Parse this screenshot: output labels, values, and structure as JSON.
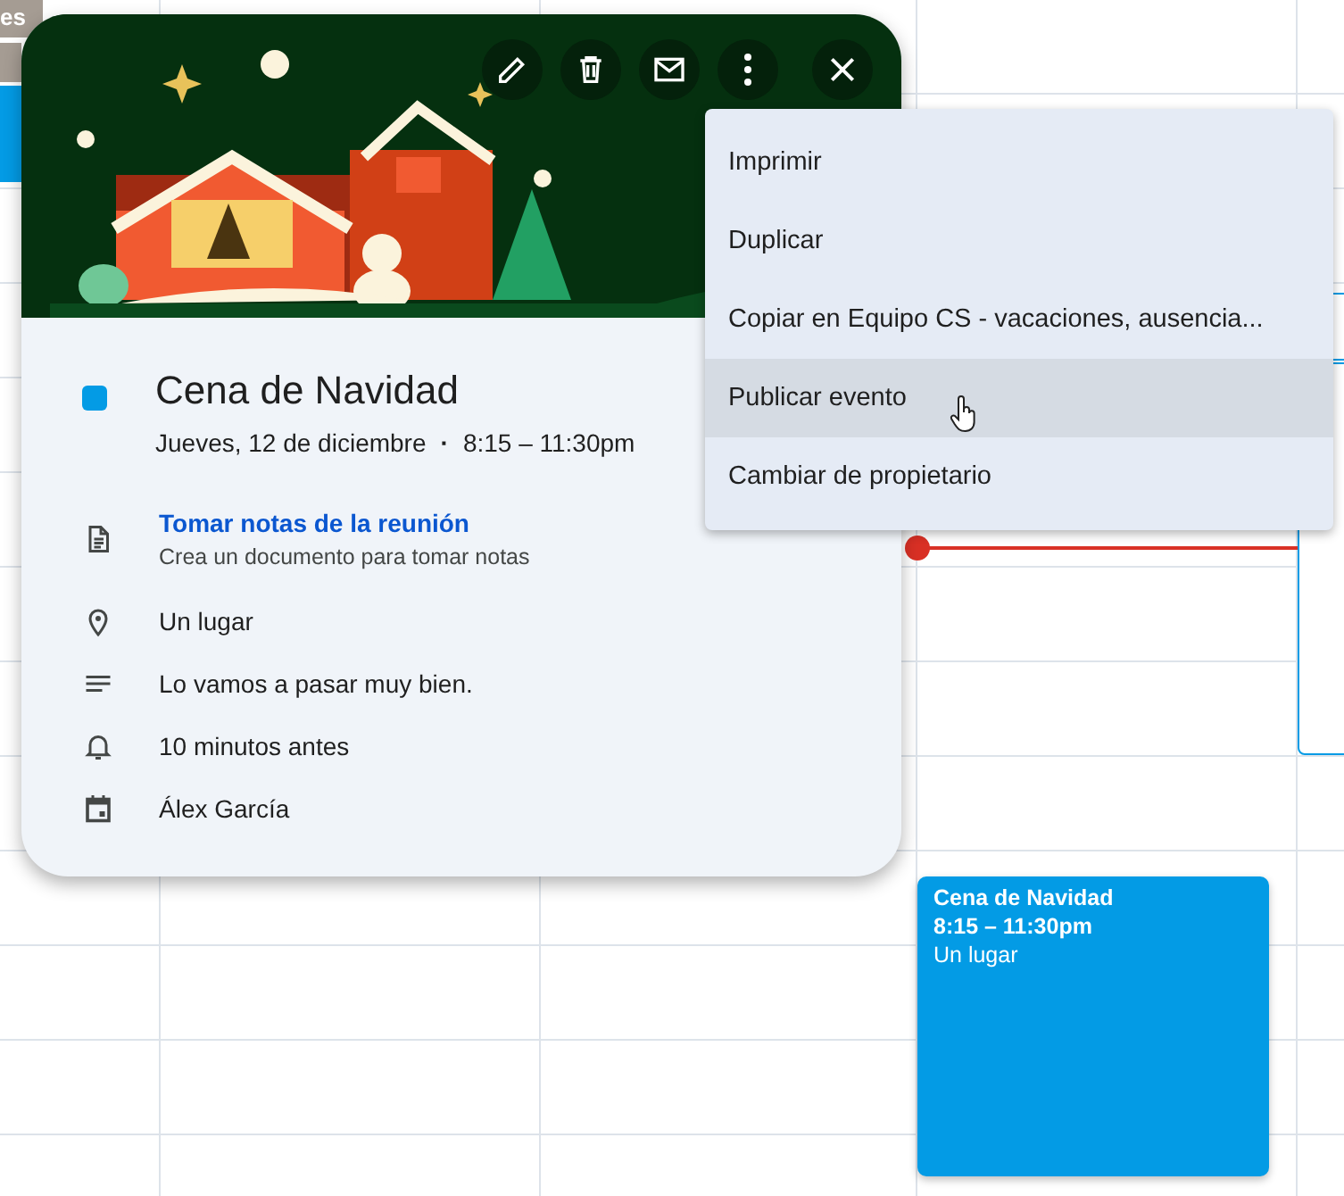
{
  "calendar": {
    "background_chips": [
      {
        "title": "es",
        "color": "#a59c93"
      }
    ],
    "event_block": {
      "title": "Cena de Navidad",
      "time": "8:15 – 11:30pm",
      "location": "Un lugar",
      "color": "#039be5"
    }
  },
  "popup": {
    "toolbar": [
      {
        "kind": "edit"
      },
      {
        "kind": "delete"
      },
      {
        "kind": "email"
      },
      {
        "kind": "more"
      },
      {
        "kind": "close"
      }
    ],
    "event": {
      "title": "Cena de Navidad",
      "color": "#039be5",
      "date": "Jueves, 12 de diciembre",
      "separator": "·",
      "time": "8:15 – 11:30pm"
    },
    "details": [
      {
        "kind": "notes",
        "title": "Tomar notas de la reunión",
        "subtitle": "Crea un documento para tomar notas"
      },
      {
        "kind": "location",
        "text": "Un lugar"
      },
      {
        "kind": "description",
        "text": "Lo vamos a pasar muy bien."
      },
      {
        "kind": "reminder",
        "text": "10 minutos antes"
      },
      {
        "kind": "calendar",
        "text": "Álex García"
      }
    ]
  },
  "menu": {
    "items": [
      {
        "label": "Imprimir",
        "hovered": false
      },
      {
        "label": "Duplicar",
        "hovered": false
      },
      {
        "label": "Copiar en Equipo CS - vacaciones, ausencia...",
        "hovered": false
      },
      {
        "label": "Publicar evento",
        "hovered": true
      },
      {
        "label": "Cambiar de propietario",
        "hovered": false
      }
    ]
  }
}
